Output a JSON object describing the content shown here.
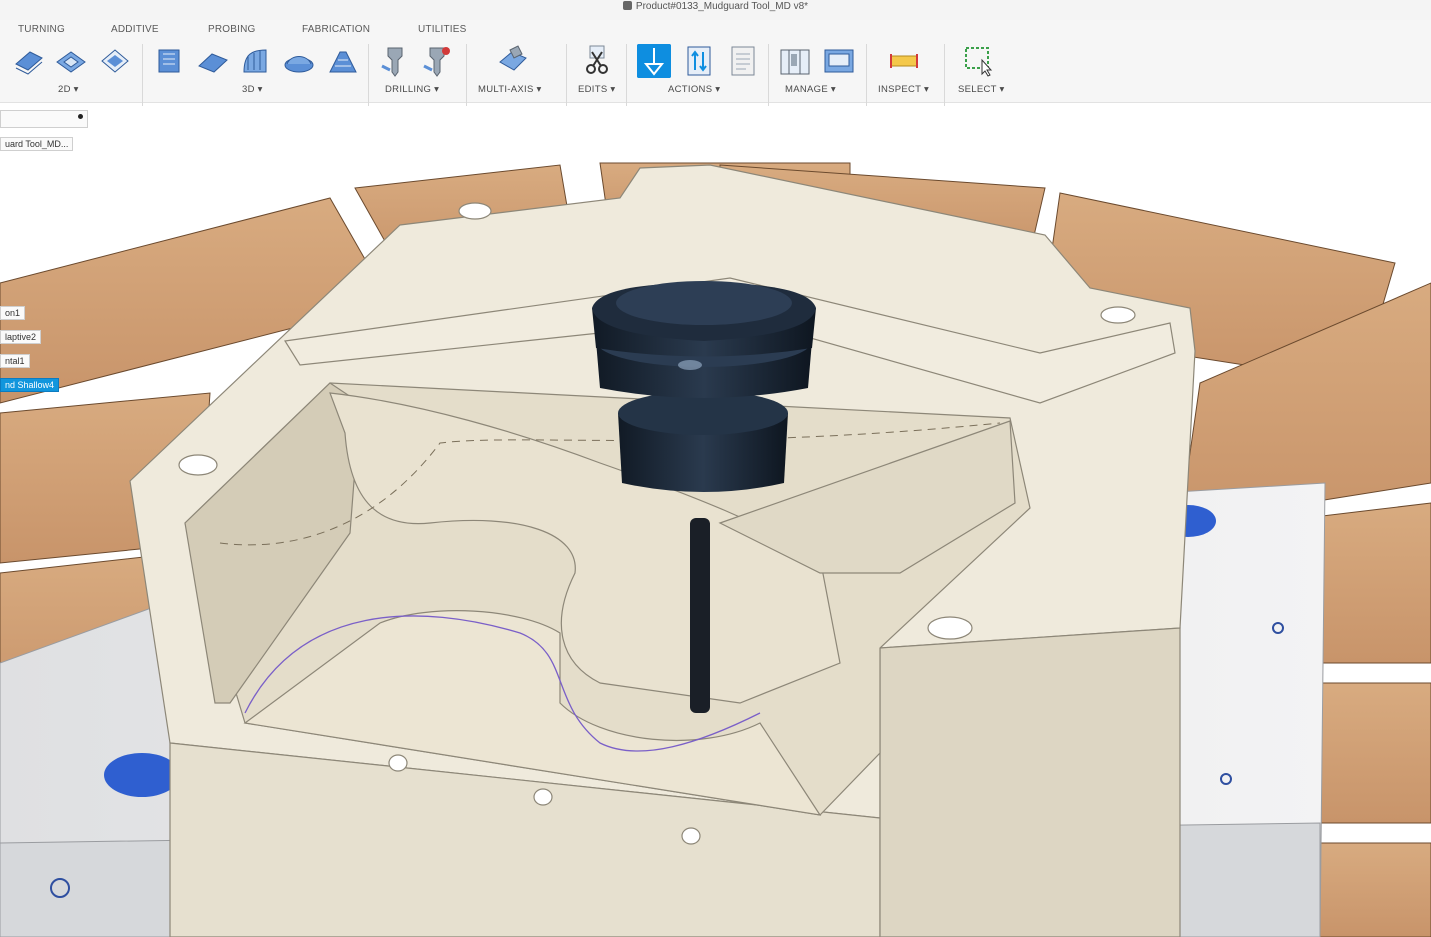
{
  "window": {
    "title": "Product#0133_Mudguard Tool_MD v8*"
  },
  "tabs": [
    "TURNING",
    "ADDITIVE",
    "PROBING",
    "FABRICATION",
    "UTILITIES"
  ],
  "groups": {
    "g2d": "2D ▾",
    "g3d": "3D ▾",
    "drilling": "DRILLING ▾",
    "multiaxis": "MULTI-AXIS ▾",
    "edits": "EDITS ▾",
    "actions": "ACTIONS ▾",
    "manage": "MANAGE ▾",
    "inspect": "INSPECT ▾",
    "select": "SELECT ▾"
  },
  "browser": {
    "search_label": "",
    "doc_label": "uard Tool_MD...",
    "items": [
      "on1",
      "laptive2",
      "ntal1",
      "nd Shallow4"
    ],
    "selected_index": 3
  },
  "colors": {
    "accent": "#0e8ee0",
    "table_wood": "#d3a57a",
    "fixture_blue": "#2f5fd0",
    "part_cream": "#e9e3d3",
    "tool_holder": "#1f2a38"
  }
}
